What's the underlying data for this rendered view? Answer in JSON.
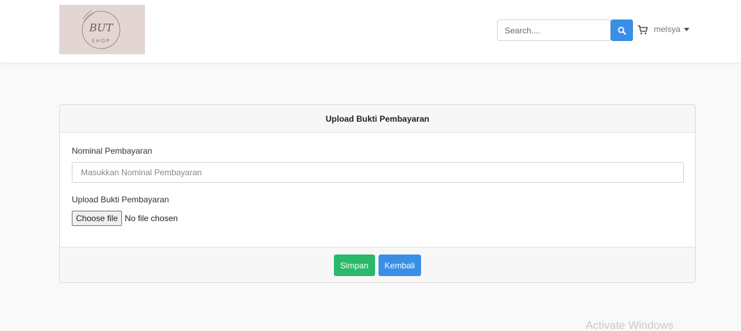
{
  "navbar": {
    "logo": {
      "main_text": "BUT",
      "sub_text": "SHOP",
      "background": "#e3d5d3"
    },
    "search": {
      "placeholder": "Search...."
    },
    "icons": {
      "search": "search-icon",
      "cart": "cart-icon",
      "dropdown": "caret-down-icon"
    },
    "user": {
      "name": "melsya"
    }
  },
  "card": {
    "title": "Upload Bukti Pembayaran",
    "nominal": {
      "label": "Nominal Pembayaran",
      "placeholder": "Masukkan Nominal Pembayaran",
      "value": ""
    },
    "upload": {
      "label": "Upload Bukti Pembayaran",
      "button_label": "Choose file",
      "status": "No file chosen"
    },
    "buttons": {
      "save": "Simpan",
      "back": "Kembali"
    }
  },
  "colors": {
    "primary": "#3a8ee6",
    "success": "#2ab86a",
    "page_background": "#f9f9f9"
  },
  "watermark": "Activate Windows"
}
